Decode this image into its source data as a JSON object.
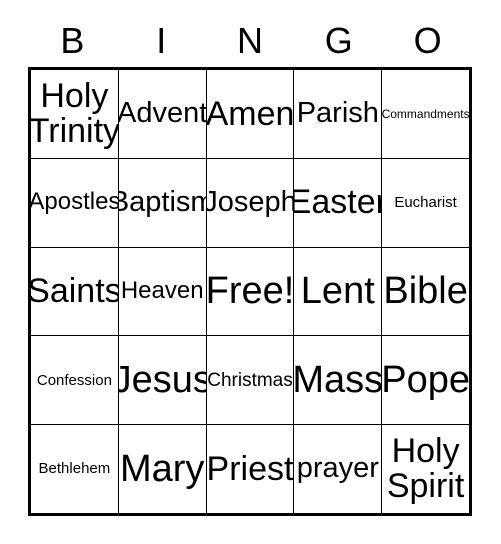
{
  "card": {
    "type": "bingo-card",
    "columns": 5,
    "rows": 5,
    "header": {
      "letters": [
        "B",
        "I",
        "N",
        "G",
        "O"
      ]
    },
    "grid": [
      [
        {
          "text": "Holy\nTrinity",
          "size": "lg",
          "free": false
        },
        {
          "text": "Advent",
          "size": "md",
          "free": false
        },
        {
          "text": "Amen",
          "size": "lg",
          "free": false
        },
        {
          "text": "Parish",
          "size": "md",
          "free": false
        },
        {
          "text": "Commandments",
          "size": "tiny",
          "free": false
        }
      ],
      [
        {
          "text": "Apostles",
          "size": "sm",
          "free": false
        },
        {
          "text": "Baptism",
          "size": "md",
          "free": false
        },
        {
          "text": "Joseph",
          "size": "md",
          "free": false
        },
        {
          "text": "Easter",
          "size": "lg",
          "free": false
        },
        {
          "text": "Eucharist",
          "size": "xxs",
          "free": false
        }
      ],
      [
        {
          "text": "Saints",
          "size": "lg",
          "free": false
        },
        {
          "text": "Heaven",
          "size": "sm",
          "free": false
        },
        {
          "text": "Free!",
          "size": "xl",
          "free": true
        },
        {
          "text": "Lent",
          "size": "xl",
          "free": false
        },
        {
          "text": "Bible",
          "size": "xl",
          "free": false
        }
      ],
      [
        {
          "text": "Confession",
          "size": "xxs",
          "free": false
        },
        {
          "text": "Jesus",
          "size": "xl",
          "free": false
        },
        {
          "text": "Christmas",
          "size": "xs",
          "free": false
        },
        {
          "text": "Mass",
          "size": "xl",
          "free": false
        },
        {
          "text": "Pope",
          "size": "xl",
          "free": false
        }
      ],
      [
        {
          "text": "Bethlehem",
          "size": "xxs",
          "free": false
        },
        {
          "text": "Mary",
          "size": "xl",
          "free": false
        },
        {
          "text": "Priest",
          "size": "lg",
          "free": false
        },
        {
          "text": "prayer",
          "size": "md",
          "free": false
        },
        {
          "text": "Holy\nSpirit",
          "size": "lg",
          "free": false
        }
      ]
    ],
    "colors": {
      "background": "#ffffff",
      "text": "#000000",
      "border": "#000000"
    }
  }
}
